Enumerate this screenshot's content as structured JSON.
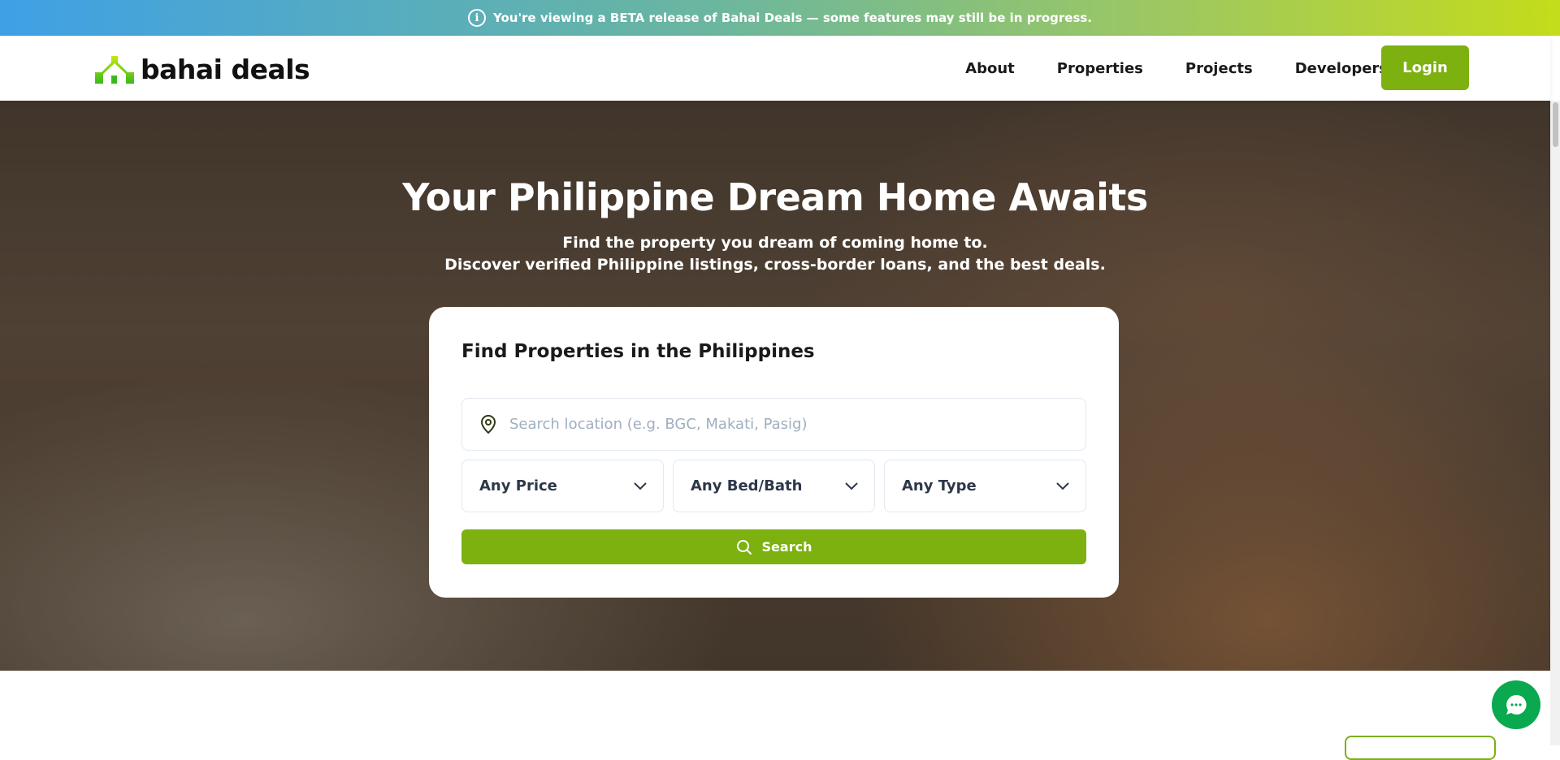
{
  "banner": {
    "text": "You're viewing a BETA release of Bahai Deals — some features may still be in progress.",
    "icon": "info-icon"
  },
  "brand": {
    "name": "bahai deals",
    "colors": {
      "accent": "#7cb10f",
      "chat": "#0aa84f"
    }
  },
  "nav": {
    "items": [
      {
        "label": "About"
      },
      {
        "label": "Properties"
      },
      {
        "label": "Projects"
      },
      {
        "label": "Developers"
      }
    ],
    "login": "Login"
  },
  "hero": {
    "title": "Your Philippine Dream Home Awaits",
    "subtitle1": "Find the property you dream of coming home to.",
    "subtitle2": "Discover verified Philippine listings, cross-border loans, and the best deals."
  },
  "search": {
    "title": "Find Properties in the Philippines",
    "placeholder": "Search location (e.g. BGC, Makati, Pasig)",
    "price": "Any Price",
    "bedbath": "Any Bed/Bath",
    "type": "Any Type",
    "button": "Search"
  }
}
